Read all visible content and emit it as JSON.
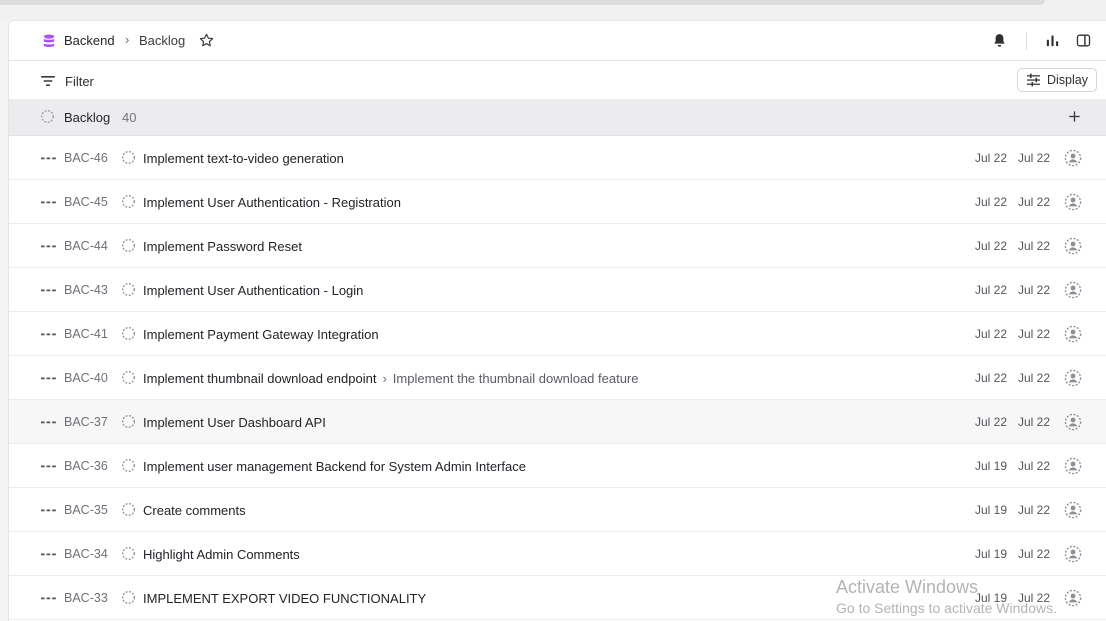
{
  "colors": {
    "accent": "#a855f7",
    "panel_bg": "#ffffff",
    "group_bg": "#ececee"
  },
  "header": {
    "project_icon": "database-icon",
    "project": "Backend",
    "separator": "›",
    "view": "Backlog",
    "favorite_icon": "star-icon",
    "right_icons": [
      "bell-icon",
      "bar-chart-icon",
      "sidebar-toggle-icon"
    ]
  },
  "toolbar": {
    "filter_icon": "filter-lines-icon",
    "filter_label": "Filter",
    "display_icon": "sliders-icon",
    "display_label": "Display"
  },
  "group": {
    "title": "Backlog",
    "count": "40",
    "status_icon": "backlog-dashed-circle-icon",
    "add_icon": "plus-icon"
  },
  "issues": [
    {
      "id": "BAC-46",
      "title": "Implement text-to-video generation",
      "parent": "",
      "created": "Jul 22",
      "updated": "Jul 22"
    },
    {
      "id": "BAC-45",
      "title": "Implement User Authentication - Registration",
      "parent": "",
      "created": "Jul 22",
      "updated": "Jul 22"
    },
    {
      "id": "BAC-44",
      "title": "Implement Password Reset",
      "parent": "",
      "created": "Jul 22",
      "updated": "Jul 22"
    },
    {
      "id": "BAC-43",
      "title": "Implement User Authentication - Login",
      "parent": "",
      "created": "Jul 22",
      "updated": "Jul 22"
    },
    {
      "id": "BAC-41",
      "title": "Implement Payment Gateway Integration",
      "parent": "",
      "created": "Jul 22",
      "updated": "Jul 22"
    },
    {
      "id": "BAC-40",
      "title": "Implement thumbnail download endpoint",
      "parent": "Implement the thumbnail download feature",
      "created": "Jul 22",
      "updated": "Jul 22"
    },
    {
      "id": "BAC-37",
      "title": "Implement User Dashboard API",
      "parent": "",
      "created": "Jul 22",
      "updated": "Jul 22"
    },
    {
      "id": "BAC-36",
      "title": "Implement user management Backend for System Admin Interface",
      "parent": "",
      "created": "Jul 19",
      "updated": "Jul 22"
    },
    {
      "id": "BAC-35",
      "title": "Create comments",
      "parent": "",
      "created": "Jul 19",
      "updated": "Jul 22"
    },
    {
      "id": "BAC-34",
      "title": "Highlight Admin Comments",
      "parent": "",
      "created": "Jul 19",
      "updated": "Jul 22"
    },
    {
      "id": "BAC-33",
      "title": "IMPLEMENT EXPORT VIDEO FUNCTIONALITY",
      "parent": "",
      "created": "Jul 19",
      "updated": "Jul 22"
    }
  ],
  "row_icons": {
    "priority": "no-priority-dashes-icon",
    "status": "backlog-dashed-circle-icon",
    "assignee": "unassigned-avatar-icon"
  },
  "watermark": {
    "line1": "Activate Windows",
    "line2": "Go to Settings to activate Windows."
  }
}
